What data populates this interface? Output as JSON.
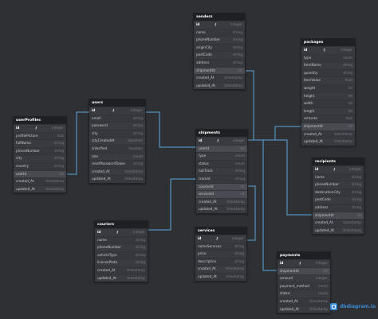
{
  "brand": {
    "name": "dbdiagram.io",
    "icon": "dbdiagram-logo-icon"
  },
  "colors": {
    "background": "#2f3034",
    "header": "#1f2023",
    "relation": "#5aa8d8"
  },
  "tables": {
    "senders": {
      "title": "senders",
      "columns": [
        {
          "name": "id",
          "type": "integer",
          "pk": true
        },
        {
          "name": "name",
          "type": "string"
        },
        {
          "name": "phoneNumber",
          "type": "string"
        },
        {
          "name": "originCity",
          "type": "string"
        },
        {
          "name": "postCode",
          "type": "string"
        },
        {
          "name": "address",
          "type": "string"
        },
        {
          "name": "shipmentId",
          "type": "int",
          "hl": true
        },
        {
          "name": "created_At",
          "type": "timestamp"
        },
        {
          "name": "updated_At",
          "type": "timestamp"
        }
      ]
    },
    "packages": {
      "title": "packages",
      "columns": [
        {
          "name": "id",
          "type": "integer",
          "pk": true
        },
        {
          "name": "type",
          "type": "enum"
        },
        {
          "name": "itemName",
          "type": "string"
        },
        {
          "name": "quantity",
          "type": "string"
        },
        {
          "name": "itemValue",
          "type": "float"
        },
        {
          "name": "weight",
          "type": "int"
        },
        {
          "name": "height",
          "type": "int"
        },
        {
          "name": "width",
          "type": "int"
        },
        {
          "name": "length",
          "type": "int"
        },
        {
          "name": "remarks",
          "type": "text"
        },
        {
          "name": "shipmentId",
          "type": "int",
          "hl": true
        },
        {
          "name": "created_At",
          "type": "timestamp"
        },
        {
          "name": "updated_At",
          "type": "timestamp"
        }
      ]
    },
    "userProfiles": {
      "title": "userProfiles",
      "columns": [
        {
          "name": "id",
          "type": "integer",
          "pk": true
        },
        {
          "name": "profilePicture",
          "type": "text"
        },
        {
          "name": "fullName",
          "type": "string"
        },
        {
          "name": "phoneNumber",
          "type": "string"
        },
        {
          "name": "city",
          "type": "string"
        },
        {
          "name": "country",
          "type": "string"
        },
        {
          "name": "userId",
          "type": "int",
          "hl": true
        },
        {
          "name": "created_At",
          "type": "timestamp"
        },
        {
          "name": "updated_At",
          "type": "timestamp"
        }
      ]
    },
    "users": {
      "title": "users",
      "columns": [
        {
          "name": "id",
          "type": "integer",
          "pk": true
        },
        {
          "name": "email",
          "type": "string"
        },
        {
          "name": "password",
          "type": "string"
        },
        {
          "name": "city",
          "type": "string"
        },
        {
          "name": "cityCreatedAt",
          "type": "datetime"
        },
        {
          "name": "isVerified",
          "type": "boolean"
        },
        {
          "name": "role",
          "type": "enum"
        },
        {
          "name": "resetPasswordToken",
          "type": "string"
        },
        {
          "name": "created_At",
          "type": "timestamp"
        },
        {
          "name": "updated_At",
          "type": "timestamp"
        }
      ]
    },
    "shipments": {
      "title": "shipments",
      "columns": [
        {
          "name": "id",
          "type": "integer",
          "pk": true
        },
        {
          "name": "userId",
          "type": "int",
          "hl": true
        },
        {
          "name": "type",
          "type": "enum"
        },
        {
          "name": "status",
          "type": "enum"
        },
        {
          "name": "notTrack",
          "type": "string"
        },
        {
          "name": "trackId",
          "type": "string"
        },
        {
          "name": "courierId",
          "type": "int",
          "hl": true
        },
        {
          "name": "serviceId",
          "type": "int",
          "hl": true
        },
        {
          "name": "created_At",
          "type": "timestamp"
        },
        {
          "name": "updated_At",
          "type": "timestamp"
        }
      ]
    },
    "recipients": {
      "title": "recipients",
      "columns": [
        {
          "name": "id",
          "type": "integer",
          "pk": true
        },
        {
          "name": "name",
          "type": "string"
        },
        {
          "name": "phoneNumber",
          "type": "string"
        },
        {
          "name": "destinationCity",
          "type": "string"
        },
        {
          "name": "postCode",
          "type": "string"
        },
        {
          "name": "address",
          "type": "string"
        },
        {
          "name": "shipmentId",
          "type": "int",
          "hl": true
        },
        {
          "name": "created_At",
          "type": "timestamp"
        },
        {
          "name": "updated_At",
          "type": "timestamp"
        }
      ]
    },
    "couriers": {
      "title": "couriers",
      "columns": [
        {
          "name": "id",
          "type": "integer",
          "pk": true
        },
        {
          "name": "name",
          "type": "string"
        },
        {
          "name": "phoneNumber",
          "type": "string"
        },
        {
          "name": "vehicleType",
          "type": "string"
        },
        {
          "name": "licensePlate",
          "type": "string"
        },
        {
          "name": "created_At",
          "type": "timestamp"
        },
        {
          "name": "updated_At",
          "type": "timestamp"
        }
      ]
    },
    "services": {
      "title": "services",
      "columns": [
        {
          "name": "id",
          "type": "integer",
          "pk": true
        },
        {
          "name": "nameServices",
          "type": "string"
        },
        {
          "name": "price",
          "type": "string"
        },
        {
          "name": "description",
          "type": "string"
        },
        {
          "name": "created_At",
          "type": "timestamp"
        },
        {
          "name": "updated_At",
          "type": "timestamp"
        }
      ]
    },
    "payments": {
      "title": "payments",
      "columns": [
        {
          "name": "id",
          "type": "integer",
          "pk": true
        },
        {
          "name": "shipmentId",
          "type": "int",
          "hl": true
        },
        {
          "name": "amount",
          "type": "integer"
        },
        {
          "name": "payment_method",
          "type": "enum"
        },
        {
          "name": "status",
          "type": "enum"
        },
        {
          "name": "created_At",
          "type": "timestamp"
        },
        {
          "name": "updated_At",
          "type": "timestamp"
        }
      ]
    }
  }
}
